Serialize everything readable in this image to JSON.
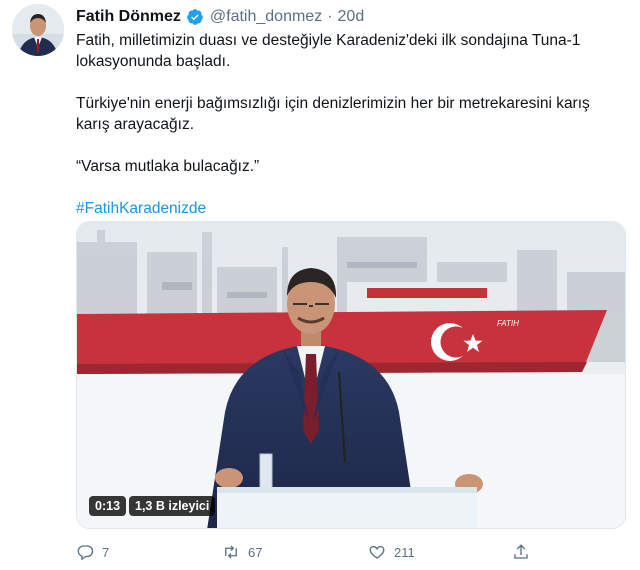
{
  "tweet": {
    "author_name": "Fatih Dönmez",
    "handle": "@fatih_donmez",
    "separator": "·",
    "time": "20d",
    "paragraphs": [
      "Fatih, milletimizin duası ve desteğiyle Karadeniz'deki ilk sondajına Tuna-1 lokasyonunda başladı.",
      "Türkiye'nin enerji bağımsızlığı için denizlerimizin her bir metrekaresini karış karış arayacağız.",
      "“Varsa mutlaka bulacağız.”"
    ],
    "hashtag": "#FatihKaradenizde"
  },
  "media": {
    "duration": "0:13",
    "views": "1,3 B izleyici",
    "ship_name": "FATIH"
  },
  "actions": {
    "reply_count": "7",
    "retweet_count": "67",
    "like_count": "211"
  },
  "colors": {
    "link": "#1b95e0",
    "verified": "#1da1f2",
    "muted": "#5b7083",
    "ship_red": "#c8323c"
  },
  "icons": [
    "verified-icon",
    "chevron-down-icon",
    "reply-icon",
    "retweet-icon",
    "like-icon",
    "share-icon"
  ]
}
